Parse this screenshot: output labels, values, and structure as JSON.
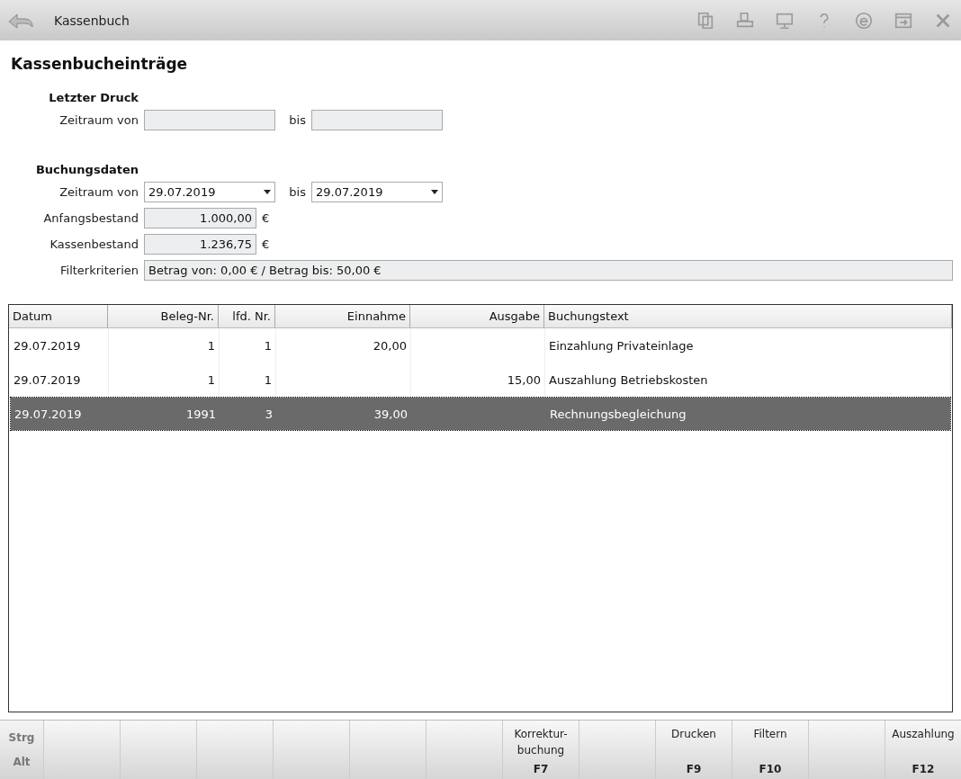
{
  "window": {
    "title": "Kassenbuch"
  },
  "toolbar_icons": [
    {
      "kind": "copy"
    },
    {
      "kind": "print"
    },
    {
      "kind": "monitor"
    },
    {
      "kind": "help"
    },
    {
      "kind": "e"
    },
    {
      "kind": "exit"
    },
    {
      "kind": "close"
    }
  ],
  "page_title": "Kassenbucheinträge",
  "last_print": {
    "heading": "Letzter Druck",
    "from_label": "Zeitraum von",
    "to_label": "bis"
  },
  "booking_data": {
    "heading": "Buchungsdaten",
    "from_label": "Zeitraum von",
    "from_value": "29.07.2019",
    "to_label": "bis",
    "to_value": "29.07.2019",
    "opening_label": "Anfangsbestand",
    "opening_value": "1.000,00",
    "opening_currency": "€",
    "balance_label": "Kassenbestand",
    "balance_value": "1.236,75",
    "balance_currency": "€",
    "filter_label": "Filterkriterien",
    "filter_value": "Betrag von: 0,00 € / Betrag bis: 50,00 €"
  },
  "table": {
    "columns": [
      "Datum",
      "Beleg-Nr.",
      "lfd. Nr.",
      "Einnahme",
      "Ausgabe",
      "Buchungstext"
    ],
    "rows": [
      {
        "cells": [
          "29.07.2019",
          "1",
          "1",
          "20,00",
          null,
          "Einzahlung Privateinlage"
        ],
        "selected": false
      },
      {
        "cells": [
          "29.07.2019",
          "1",
          "1",
          null,
          "15,00",
          "Auszahlung Betriebskosten"
        ],
        "selected": false
      },
      {
        "cells": [
          "29.07.2019",
          "1991",
          "3",
          "39,00",
          null,
          "Rechnungsbegleichung"
        ],
        "selected": true
      }
    ]
  },
  "modifier_keys": [
    "Strg",
    "Alt"
  ],
  "function_keys": [
    {
      "kind": "empty"
    },
    {
      "kind": "empty"
    },
    {
      "kind": "empty"
    },
    {
      "kind": "empty"
    },
    {
      "kind": "empty"
    },
    {
      "kind": "empty"
    },
    {
      "kind": "key",
      "label": "Korrektur-\nbuchung",
      "key": "F7"
    },
    {
      "kind": "empty"
    },
    {
      "kind": "key",
      "label": "Drucken",
      "key": "F9"
    },
    {
      "kind": "key",
      "label": "Filtern",
      "key": "F10"
    },
    {
      "kind": "empty"
    },
    {
      "kind": "key",
      "label": "Auszahlung",
      "key": "F12"
    }
  ]
}
